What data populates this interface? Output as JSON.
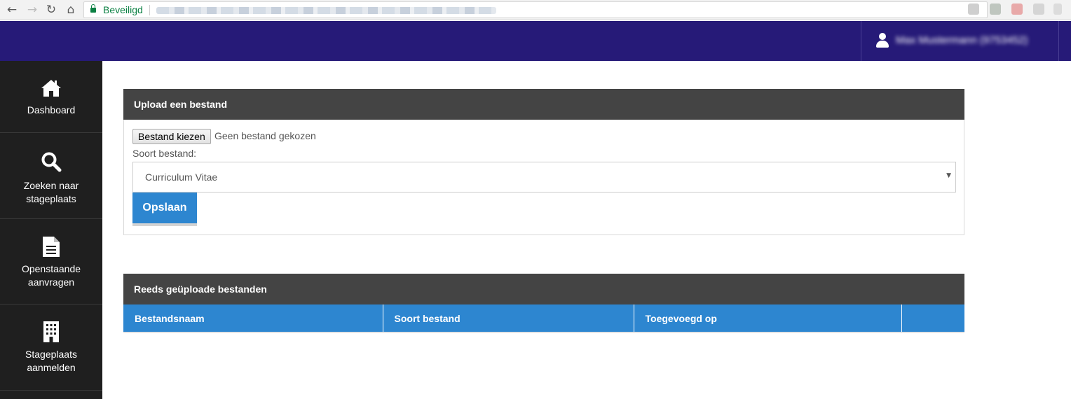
{
  "browser": {
    "secure_label": "Beveiligd",
    "icons": {
      "back": "arrow-left-icon",
      "forward": "arrow-right-icon",
      "reload": "reload-icon",
      "home": "home-icon",
      "lock": "lock-icon"
    },
    "accent": "#0b8043"
  },
  "header": {
    "background": "#261a78",
    "user_name": "Max Mustermann (9753452)",
    "user_icon": "user-icon"
  },
  "sidebar": {
    "background": "#1f1f1f",
    "items": [
      {
        "label": "Dashboard",
        "icon": "home-icon"
      },
      {
        "label": "Zoeken naar stageplaats",
        "icon": "search-icon"
      },
      {
        "label": "Openstaande aanvragen",
        "icon": "document-icon"
      },
      {
        "label": "Stageplaats aanmelden",
        "icon": "building-icon"
      }
    ]
  },
  "upload": {
    "title": "Upload een bestand",
    "file_button": "Bestand kiezen",
    "file_status": "Geen bestand gekozen",
    "type_label": "Soort bestand:",
    "type_selected": "Curriculum Vitae",
    "save_label": "Opslaan"
  },
  "files": {
    "title": "Reeds geüploade bestanden",
    "columns": [
      "Bestandsnaam",
      "Soort bestand",
      "Toegevoegd op",
      ""
    ],
    "rows": []
  },
  "colors": {
    "primary": "#2d86d0",
    "panel_header": "#444444"
  }
}
